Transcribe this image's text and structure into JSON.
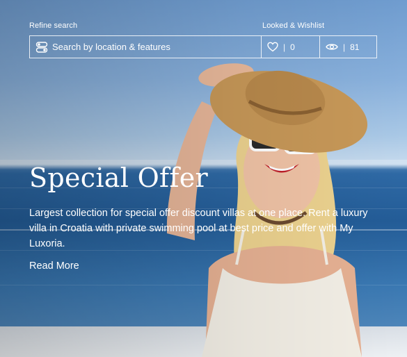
{
  "header": {
    "refine_label": "Refine search",
    "looked_label": "Looked & Wishlist"
  },
  "search": {
    "placeholder": "Search by location & features",
    "icon": "filter-toggle-icon"
  },
  "stats": {
    "wishlist": {
      "icon": "heart-icon",
      "separator": "|",
      "count": "0"
    },
    "views": {
      "icon": "eye-icon",
      "separator": "|",
      "count": "81"
    }
  },
  "hero": {
    "title": "Special Offer",
    "description": "Largest collection for special offer discount villas at one place. Rent a luxury villa in Croatia with private swimming pool at best price and offer with My Luxoria.",
    "cta": "Read More"
  },
  "colors": {
    "text": "#ffffff",
    "sky": "#88b0dc",
    "sea": "#235c97",
    "hat": "#c89a5a",
    "dress": "#f3efe6"
  }
}
